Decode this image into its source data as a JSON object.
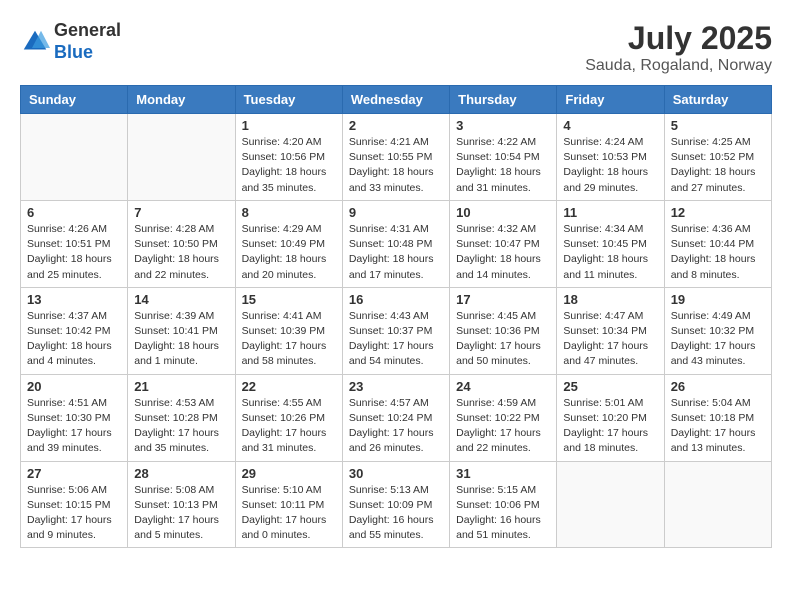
{
  "header": {
    "logo_general": "General",
    "logo_blue": "Blue",
    "month_year": "July 2025",
    "location": "Sauda, Rogaland, Norway"
  },
  "weekdays": [
    "Sunday",
    "Monday",
    "Tuesday",
    "Wednesday",
    "Thursday",
    "Friday",
    "Saturday"
  ],
  "weeks": [
    [
      {
        "day": "",
        "info": ""
      },
      {
        "day": "",
        "info": ""
      },
      {
        "day": "1",
        "info": "Sunrise: 4:20 AM\nSunset: 10:56 PM\nDaylight: 18 hours and 35 minutes."
      },
      {
        "day": "2",
        "info": "Sunrise: 4:21 AM\nSunset: 10:55 PM\nDaylight: 18 hours and 33 minutes."
      },
      {
        "day": "3",
        "info": "Sunrise: 4:22 AM\nSunset: 10:54 PM\nDaylight: 18 hours and 31 minutes."
      },
      {
        "day": "4",
        "info": "Sunrise: 4:24 AM\nSunset: 10:53 PM\nDaylight: 18 hours and 29 minutes."
      },
      {
        "day": "5",
        "info": "Sunrise: 4:25 AM\nSunset: 10:52 PM\nDaylight: 18 hours and 27 minutes."
      }
    ],
    [
      {
        "day": "6",
        "info": "Sunrise: 4:26 AM\nSunset: 10:51 PM\nDaylight: 18 hours and 25 minutes."
      },
      {
        "day": "7",
        "info": "Sunrise: 4:28 AM\nSunset: 10:50 PM\nDaylight: 18 hours and 22 minutes."
      },
      {
        "day": "8",
        "info": "Sunrise: 4:29 AM\nSunset: 10:49 PM\nDaylight: 18 hours and 20 minutes."
      },
      {
        "day": "9",
        "info": "Sunrise: 4:31 AM\nSunset: 10:48 PM\nDaylight: 18 hours and 17 minutes."
      },
      {
        "day": "10",
        "info": "Sunrise: 4:32 AM\nSunset: 10:47 PM\nDaylight: 18 hours and 14 minutes."
      },
      {
        "day": "11",
        "info": "Sunrise: 4:34 AM\nSunset: 10:45 PM\nDaylight: 18 hours and 11 minutes."
      },
      {
        "day": "12",
        "info": "Sunrise: 4:36 AM\nSunset: 10:44 PM\nDaylight: 18 hours and 8 minutes."
      }
    ],
    [
      {
        "day": "13",
        "info": "Sunrise: 4:37 AM\nSunset: 10:42 PM\nDaylight: 18 hours and 4 minutes."
      },
      {
        "day": "14",
        "info": "Sunrise: 4:39 AM\nSunset: 10:41 PM\nDaylight: 18 hours and 1 minute."
      },
      {
        "day": "15",
        "info": "Sunrise: 4:41 AM\nSunset: 10:39 PM\nDaylight: 17 hours and 58 minutes."
      },
      {
        "day": "16",
        "info": "Sunrise: 4:43 AM\nSunset: 10:37 PM\nDaylight: 17 hours and 54 minutes."
      },
      {
        "day": "17",
        "info": "Sunrise: 4:45 AM\nSunset: 10:36 PM\nDaylight: 17 hours and 50 minutes."
      },
      {
        "day": "18",
        "info": "Sunrise: 4:47 AM\nSunset: 10:34 PM\nDaylight: 17 hours and 47 minutes."
      },
      {
        "day": "19",
        "info": "Sunrise: 4:49 AM\nSunset: 10:32 PM\nDaylight: 17 hours and 43 minutes."
      }
    ],
    [
      {
        "day": "20",
        "info": "Sunrise: 4:51 AM\nSunset: 10:30 PM\nDaylight: 17 hours and 39 minutes."
      },
      {
        "day": "21",
        "info": "Sunrise: 4:53 AM\nSunset: 10:28 PM\nDaylight: 17 hours and 35 minutes."
      },
      {
        "day": "22",
        "info": "Sunrise: 4:55 AM\nSunset: 10:26 PM\nDaylight: 17 hours and 31 minutes."
      },
      {
        "day": "23",
        "info": "Sunrise: 4:57 AM\nSunset: 10:24 PM\nDaylight: 17 hours and 26 minutes."
      },
      {
        "day": "24",
        "info": "Sunrise: 4:59 AM\nSunset: 10:22 PM\nDaylight: 17 hours and 22 minutes."
      },
      {
        "day": "25",
        "info": "Sunrise: 5:01 AM\nSunset: 10:20 PM\nDaylight: 17 hours and 18 minutes."
      },
      {
        "day": "26",
        "info": "Sunrise: 5:04 AM\nSunset: 10:18 PM\nDaylight: 17 hours and 13 minutes."
      }
    ],
    [
      {
        "day": "27",
        "info": "Sunrise: 5:06 AM\nSunset: 10:15 PM\nDaylight: 17 hours and 9 minutes."
      },
      {
        "day": "28",
        "info": "Sunrise: 5:08 AM\nSunset: 10:13 PM\nDaylight: 17 hours and 5 minutes."
      },
      {
        "day": "29",
        "info": "Sunrise: 5:10 AM\nSunset: 10:11 PM\nDaylight: 17 hours and 0 minutes."
      },
      {
        "day": "30",
        "info": "Sunrise: 5:13 AM\nSunset: 10:09 PM\nDaylight: 16 hours and 55 minutes."
      },
      {
        "day": "31",
        "info": "Sunrise: 5:15 AM\nSunset: 10:06 PM\nDaylight: 16 hours and 51 minutes."
      },
      {
        "day": "",
        "info": ""
      },
      {
        "day": "",
        "info": ""
      }
    ]
  ]
}
